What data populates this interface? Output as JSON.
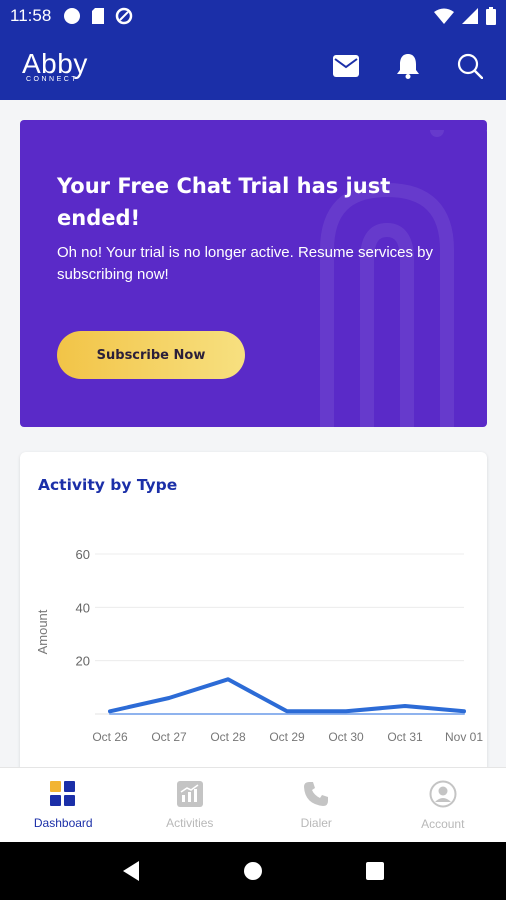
{
  "status_bar": {
    "time": "11:58"
  },
  "app_bar": {
    "logo_main": "Abby",
    "logo_sub": "CONNECT"
  },
  "banner": {
    "title": "Your Free Chat Trial has just ended!",
    "text": "Oh no! Your trial is no longer active. Resume services by subscribing now!",
    "button_label": "Subscribe Now"
  },
  "chart_card": {
    "title": "Activity by Type"
  },
  "chart_data": {
    "type": "line",
    "title": "Activity by Type",
    "xlabel": "",
    "ylabel": "Amount",
    "categories": [
      "Oct 26",
      "Oct 27",
      "Oct 28",
      "Oct 29",
      "Oct 30",
      "Oct 31",
      "Nov 01"
    ],
    "yticks": [
      60,
      40,
      20
    ],
    "ylim": [
      0,
      60
    ],
    "grid": true,
    "series": [
      {
        "values": [
          1,
          6,
          13,
          1,
          1,
          3,
          1
        ],
        "color": "#2c6bd6"
      },
      {
        "values": [
          0,
          0,
          0,
          0,
          0,
          0,
          0
        ],
        "color": "#8fb3ee"
      }
    ]
  },
  "bottom_nav": {
    "items": [
      {
        "label": "Dashboard",
        "icon": "dashboard-icon",
        "active": true
      },
      {
        "label": "Activities",
        "icon": "activities-icon",
        "active": false
      },
      {
        "label": "Dialer",
        "icon": "phone-icon",
        "active": false
      },
      {
        "label": "Account",
        "icon": "account-icon",
        "active": false
      }
    ]
  },
  "colors": {
    "primary": "#1b2fa8",
    "banner": "#5a2ac8",
    "accent": "#f2c447"
  }
}
